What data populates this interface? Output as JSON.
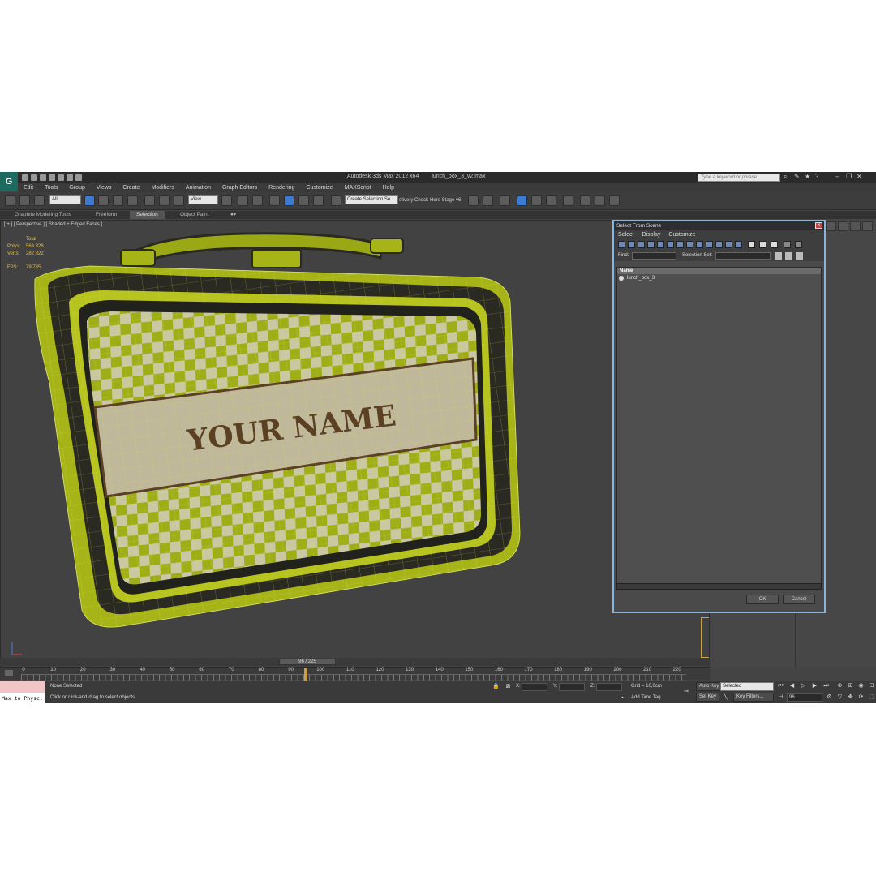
{
  "app": {
    "logo_glyph": "G",
    "title_product": "Autodesk 3ds Max  2012 x64",
    "title_file": "lunch_box_3_v2.max",
    "search_placeholder": "Type a keyword or phrase"
  },
  "menu": [
    "Edit",
    "Tools",
    "Group",
    "Views",
    "Create",
    "Modifiers",
    "Animation",
    "Graph Editors",
    "Rendering",
    "Customize",
    "MAXScript",
    "Help"
  ],
  "toolbar": {
    "filter_value": "All",
    "coord_value": "View",
    "selection_set_value": "Create Selection Se",
    "delivery_text": "elivery Check",
    "hero_text": "Hero Stage v6"
  },
  "ribbon": {
    "tabs": [
      "Graphite Modeling Tools",
      "Freeform",
      "Selection",
      "Object Paint"
    ],
    "active": "Selection"
  },
  "viewport": {
    "label": "[ + ] [ Perspective ] [ Shaded + Edged Faces ]",
    "stats": {
      "header": "Total",
      "polys_label": "Polys:",
      "polys_value": "563 328",
      "verts_label": "Verts:",
      "verts_value": "282 822",
      "fps_label": "FPS:",
      "fps_value": "79,735"
    },
    "model_text": "YOUR NAME"
  },
  "dialog": {
    "title": "Select From Scene",
    "close": "x",
    "menu": [
      "Select",
      "Display",
      "Customize"
    ],
    "find_label": "Find:",
    "selection_set_label": "Selection Set:",
    "column_name": "Name",
    "items": [
      "lunch_box_3"
    ],
    "ok": "OK",
    "cancel": "Cancel"
  },
  "timeline": {
    "slider": "96 / 225",
    "ticks": [
      "0",
      "10",
      "20",
      "30",
      "40",
      "50",
      "60",
      "70",
      "80",
      "90",
      "100",
      "110",
      "120",
      "130",
      "140",
      "150",
      "160",
      "170",
      "180",
      "190",
      "200",
      "210",
      "220"
    ]
  },
  "status": {
    "listener_text": "Max to Physc.",
    "selection": "None Selected",
    "prompt": "Click or click-and-drag to select objects",
    "x_label": "X:",
    "y_label": "Y:",
    "z_label": "Z:",
    "grid": "Grid = 10,0cm",
    "add_time_tag": "Add Time Tag",
    "auto_key": "Auto Key",
    "set_key": "Set Key",
    "key_mode_value": "Selected",
    "key_filters": "Key Filters...",
    "frame_value": "96"
  },
  "colors": {
    "accent": "#3d7bd3",
    "model_yellow": "#b9c51a",
    "model_dark": "#2a2a22",
    "checker_light": "#c8c8a0",
    "banner": "#bfb89a",
    "text_brown": "#5b4023"
  }
}
